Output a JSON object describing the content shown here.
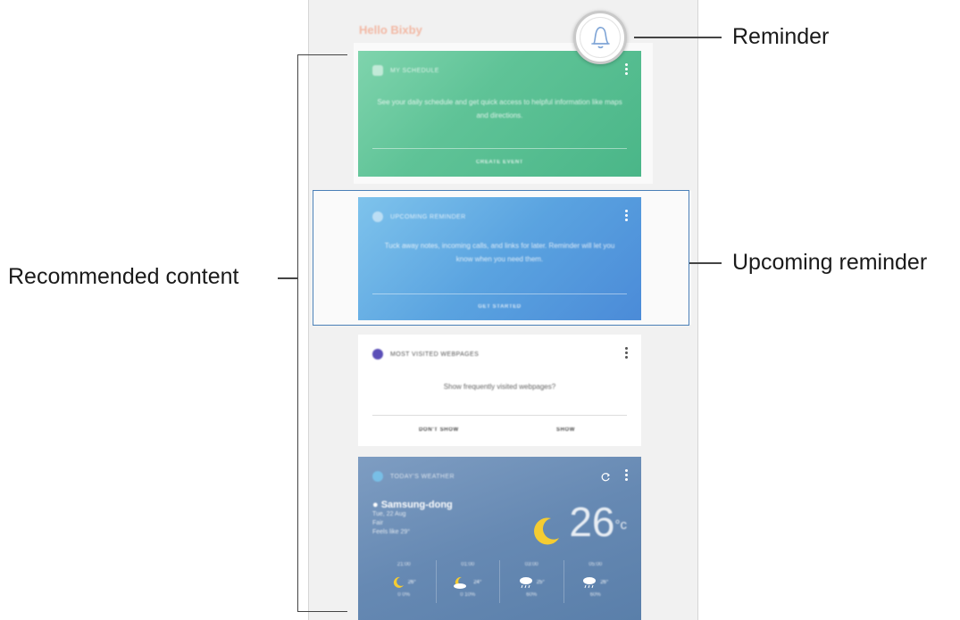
{
  "screen": {
    "greeting": "Hello Bixby"
  },
  "cards": {
    "schedule": {
      "title": "MY SCHEDULE",
      "body": "See your daily schedule and get quick access to helpful information like maps and directions.",
      "action": "CREATE EVENT"
    },
    "reminder": {
      "title": "UPCOMING REMINDER",
      "body": "Tuck away notes, incoming calls, and links for later. Reminder will let you know when you need them.",
      "action": "GET STARTED"
    },
    "webpages": {
      "title": "MOST VISITED WEBPAGES",
      "body": "Show frequently visited webpages?",
      "action_left": "DON'T SHOW",
      "action_right": "SHOW"
    },
    "weather": {
      "title": "TODAY'S WEATHER",
      "location": "Samsung-dong",
      "date": "Tue, 22 Aug",
      "condition": "Fair",
      "feels_like": "Feels like 29°",
      "temperature": "26",
      "unit": "°c",
      "forecast": [
        {
          "time": "21:00",
          "icon": "moon-icon",
          "temp": "26°",
          "precip": "0 0%"
        },
        {
          "time": "01:00",
          "icon": "moon-cloud-icon",
          "temp": "24°",
          "precip": "0 10%"
        },
        {
          "time": "03:00",
          "icon": "rain-icon",
          "temp": "25°",
          "precip": "60%"
        },
        {
          "time": "05:00",
          "icon": "rain-icon",
          "temp": "26°",
          "precip": "60%"
        }
      ]
    }
  },
  "annotations": {
    "reminder": "Reminder",
    "upcoming_reminder": "Upcoming reminder",
    "recommended_content": "Recommended content"
  },
  "colors": {
    "schedule_card": "#5fc397",
    "reminder_card": "#5aa3e0",
    "weather_card": "#6689b3",
    "highlight_box": "#4a7fb7"
  }
}
